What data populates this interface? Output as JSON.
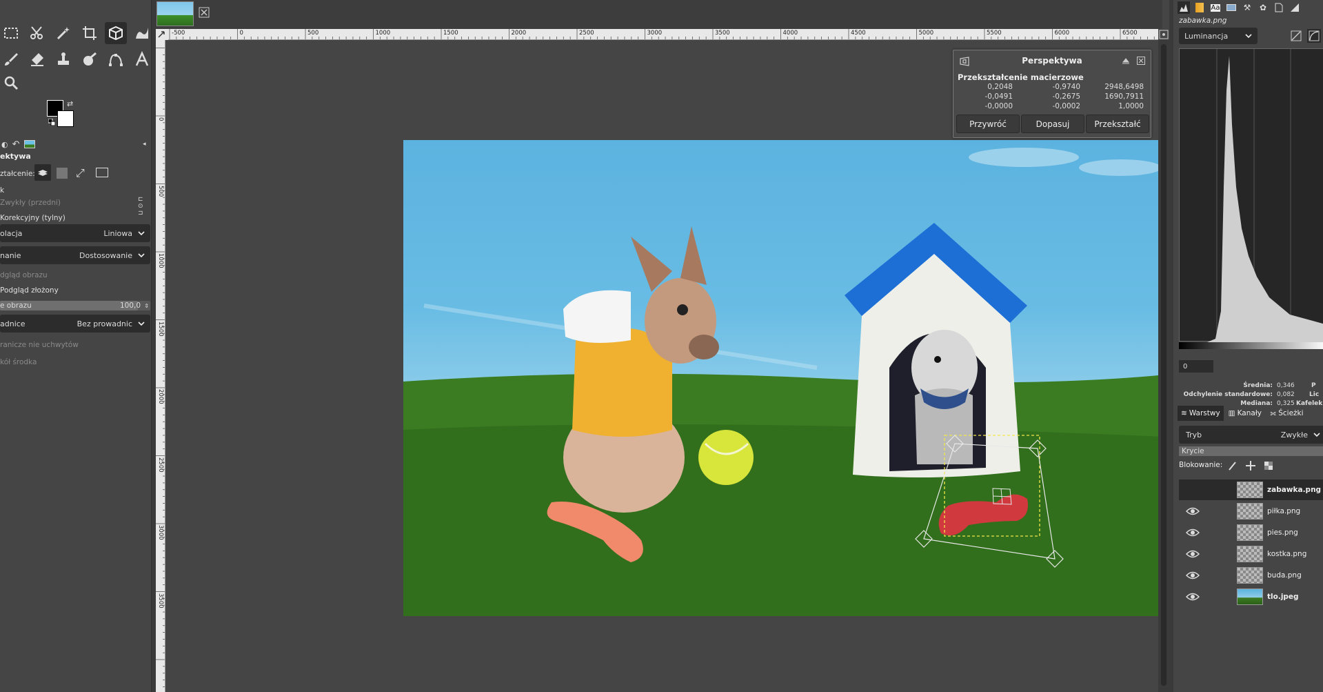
{
  "tool_options": {
    "title": "ektywa",
    "transform_label": "ztałcenie:",
    "direction_label": "k",
    "direction_normal": "Zwykły (przedni)",
    "direction_corrective": "Korekcyjny (tylny)",
    "interpolation_label": "olacja",
    "interpolation_value": "Liniowa",
    "clipping_label": "nanie",
    "clipping_value": "Dostosowanie",
    "preview_image": "dgląd obrazu",
    "preview_composite": "Podgląd złożony",
    "opacity_label": "e obrazu",
    "opacity_value": "100,0",
    "guides_label": "adnice",
    "guides_value": "Bez prowadnic",
    "constrain_handles": "ranicze nie uchwytów",
    "around_center": "kół środka"
  },
  "rulers": {
    "horizontal": [
      "-500",
      "0",
      "500",
      "1000",
      "1500",
      "2000",
      "2500",
      "3000",
      "3500",
      "4000",
      "4500",
      "5000",
      "5500",
      "6000",
      "6500"
    ],
    "vertical": [
      "0",
      "500",
      "1000",
      "1500",
      "2000",
      "2500",
      "3000",
      "3500"
    ]
  },
  "perspective_dialog": {
    "title": "Perspektywa",
    "matrix_title": "Przekształcenie macierzowe",
    "matrix": [
      [
        "0,2048",
        "-0,9740",
        "2948,6498"
      ],
      [
        "-0,0491",
        "-0,2675",
        "1690,7911"
      ],
      [
        "-0,0000",
        "-0,0002",
        "1,0000"
      ]
    ],
    "buttons": {
      "reset": "Przywróć",
      "readjust": "Dopasuj",
      "transform": "Przekształć"
    }
  },
  "histogram": {
    "filename": "zabawka.png",
    "channel": "Luminancja",
    "range_low": "0",
    "stats": [
      {
        "label": "Średnia:",
        "value": "0,346",
        "extra": "P"
      },
      {
        "label": "Odchylenie standardowe:",
        "value": "0,082",
        "extra": "Lic"
      },
      {
        "label": "Mediana:",
        "value": "0,325",
        "extra": "Kafelek prz"
      }
    ]
  },
  "layers_panel": {
    "tabs": {
      "layers": "Warstwy",
      "channels": "Kanały",
      "paths": "Ścieżki"
    },
    "mode_label": "Tryb",
    "mode_value": "Zwykłe",
    "opacity_label": "Krycie",
    "lock_label": "Blokowanie:",
    "layers": [
      {
        "name": "zabawka.png",
        "visible": false,
        "selected": true
      },
      {
        "name": "piłka.png",
        "visible": true,
        "selected": false
      },
      {
        "name": "pies.png",
        "visible": true,
        "selected": false
      },
      {
        "name": "kostka.png",
        "visible": true,
        "selected": false
      },
      {
        "name": "buda.png",
        "visible": true,
        "selected": false
      },
      {
        "name": "tlo.jpeg",
        "visible": true,
        "selected": false
      }
    ]
  },
  "colors": {
    "accent_blue": "#1d6fd6",
    "sky": "#5cb3df",
    "grass": "#3a7a22"
  }
}
